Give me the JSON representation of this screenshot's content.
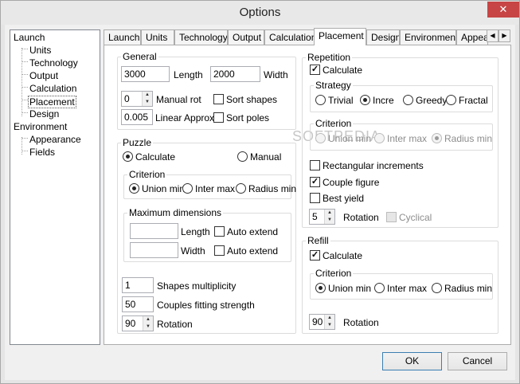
{
  "window": {
    "title": "Options",
    "close_glyph": "✕"
  },
  "tree": {
    "items": [
      {
        "label": "Launch"
      },
      {
        "label": "Units"
      },
      {
        "label": "Technology"
      },
      {
        "label": "Output"
      },
      {
        "label": "Calculation"
      },
      {
        "label": "Placement"
      },
      {
        "label": "Design"
      },
      {
        "label": "Environment"
      },
      {
        "label": "Appearance"
      },
      {
        "label": "Fields"
      }
    ]
  },
  "tabs": [
    "Launch",
    "Units",
    "Technology",
    "Output",
    "Calculation",
    "Placement",
    "Design",
    "Environment",
    "Appea"
  ],
  "tab_scroll": {
    "left": "◀",
    "right": "▶"
  },
  "watermark": "SOFTPEDIA",
  "general": {
    "title": "General",
    "length_value": "3000",
    "length_label": "Length",
    "width_value": "2000",
    "width_label": "Width",
    "manual_rot_value": "0",
    "manual_rot_label": "Manual rot",
    "sort_shapes_label": "Sort shapes",
    "linear_value": "0.005",
    "linear_label": "Linear Approx",
    "sort_poles_label": "Sort poles"
  },
  "puzzle": {
    "title": "Puzzle",
    "calculate_label": "Calculate",
    "manual_label": "Manual",
    "criterion_title": "Criterion",
    "union_min": "Union min",
    "inter_max": "Inter max",
    "radius_min": "Radius min",
    "maxdim_title": "Maximum dimensions",
    "length_label": "Length",
    "width_label": "Width",
    "auto_extend_1": "Auto extend",
    "auto_extend_2": "Auto extend",
    "shapes_mult_value": "1",
    "shapes_mult_label": "Shapes multiplicity",
    "couples_value": "50",
    "couples_label": "Couples fitting strength",
    "rotation_value": "90",
    "rotation_label": "Rotation"
  },
  "repetition": {
    "title": "Repetition",
    "calculate_label": "Calculate",
    "strategy_title": "Strategy",
    "trivial": "Trivial",
    "incre": "Incre",
    "greedy": "Greedy",
    "fractal": "Fractal",
    "criterion_title": "Criterion",
    "union_min": "Union min",
    "inter_max": "Inter max",
    "radius_min": "Radius min",
    "rect_incr_label": "Rectangular increments",
    "couple_fig_label": "Couple figure",
    "best_yield_label": "Best yield",
    "rotation_value": "5",
    "rotation_label": "Rotation",
    "cyclical_label": "Cyclical"
  },
  "refill": {
    "title": "Refill",
    "calculate_label": "Calculate",
    "criterion_title": "Criterion",
    "union_min": "Union min",
    "inter_max": "Inter max",
    "radius_min": "Radius min",
    "rotation_value": "90",
    "rotation_label": "Rotation"
  },
  "buttons": {
    "ok": "OK",
    "cancel": "Cancel"
  },
  "check_glyph": "✓",
  "spin_up": "▲",
  "spin_down": "▼"
}
